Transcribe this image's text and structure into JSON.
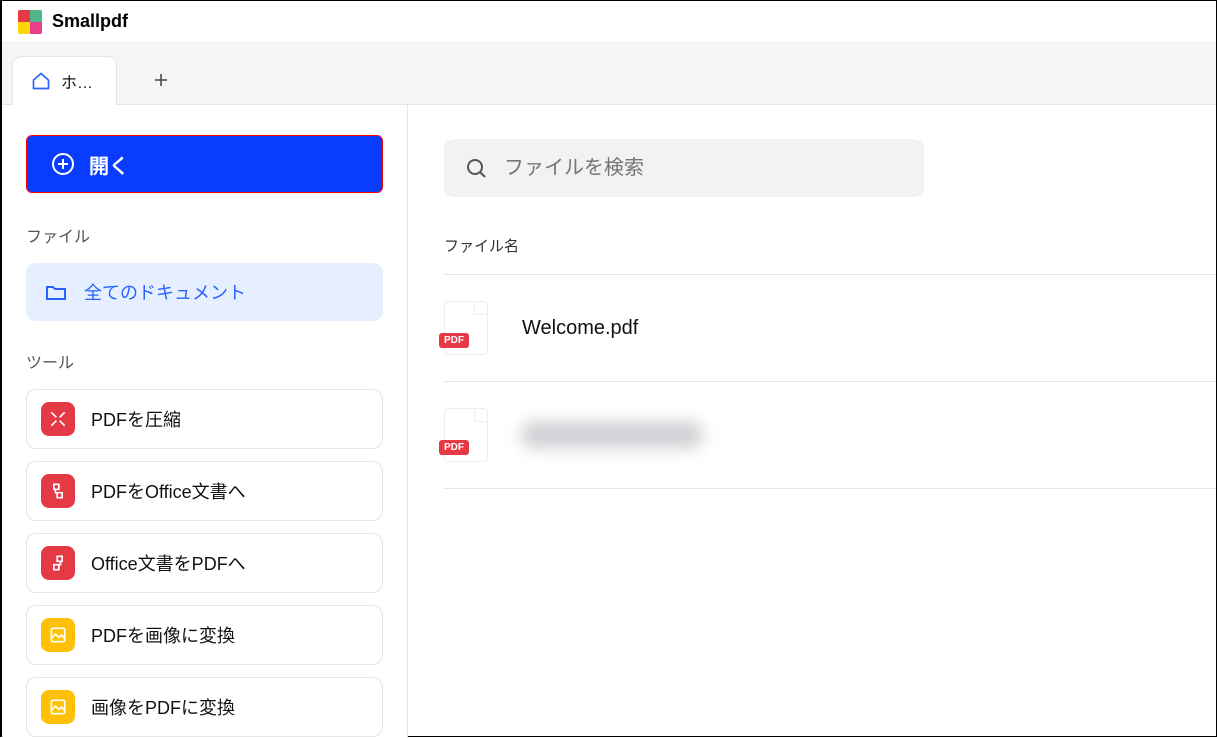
{
  "app": {
    "title": "Smallpdf"
  },
  "tabs": {
    "home_label": "ホ…"
  },
  "sidebar": {
    "open_label": "開く",
    "files_section": "ファイル",
    "all_docs": "全てのドキュメント",
    "tools_section": "ツール",
    "tools": [
      {
        "label": "PDFを圧縮"
      },
      {
        "label": "PDFをOffice文書へ"
      },
      {
        "label": "Office文書をPDFへ"
      },
      {
        "label": "PDFを画像に変換"
      },
      {
        "label": "画像をPDFに変換"
      }
    ]
  },
  "main": {
    "search_placeholder": "ファイルを検索",
    "col_filename": "ファイル名",
    "pdf_badge": "PDF",
    "files": [
      {
        "name": "Welcome.pdf"
      },
      {
        "name": ""
      }
    ]
  }
}
